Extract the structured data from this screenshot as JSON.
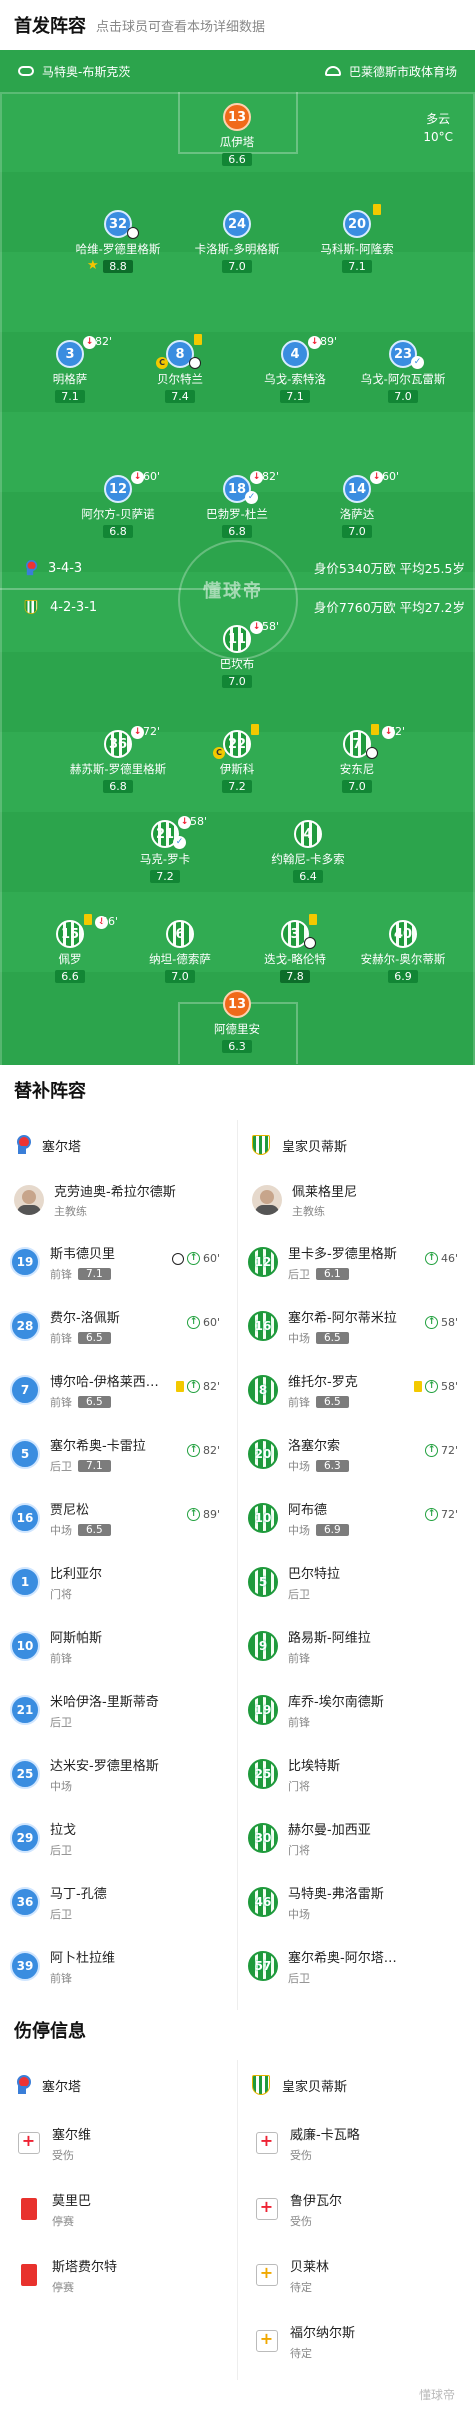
{
  "header": {
    "title": "首发阵容",
    "subtitle": "点击球员可查看本场详细数据"
  },
  "pitch": {
    "coach_home": "马特奥-布斯克茨",
    "venue": "巴莱德斯市政体育场",
    "weather": "多云",
    "temperature": "10°C",
    "watermark": "懂球帝",
    "home": {
      "formation": "3-4-3",
      "value": "身价5340万欧",
      "age": "平均25.5岁"
    },
    "away": {
      "formation": "4-2-3-1",
      "value": "身价7760万欧",
      "age": "平均27.2岁"
    },
    "home_players": [
      {
        "num": "13",
        "name": "瓜伊塔",
        "rating": "6.6"
      },
      {
        "num": "32",
        "name": "哈维-罗德里格斯",
        "rating": "8.8"
      },
      {
        "num": "24",
        "name": "卡洛斯-多明格斯",
        "rating": "7.0"
      },
      {
        "num": "20",
        "name": "马科斯-阿隆索",
        "rating": "7.1"
      },
      {
        "num": "3",
        "name": "明格萨",
        "rating": "7.1",
        "sub": "82'"
      },
      {
        "num": "8",
        "name": "贝尔特兰",
        "rating": "7.4"
      },
      {
        "num": "4",
        "name": "乌戈-索特洛",
        "rating": "7.1",
        "sub": "89'"
      },
      {
        "num": "23",
        "name": "乌戈-阿尔瓦雷斯",
        "rating": "7.0"
      },
      {
        "num": "12",
        "name": "阿尔方-贝萨诺",
        "rating": "6.8",
        "sub": "60'"
      },
      {
        "num": "18",
        "name": "巴勃罗-杜兰",
        "rating": "6.8",
        "sub": "82'"
      },
      {
        "num": "14",
        "name": "洛萨达",
        "rating": "7.0",
        "sub": "60'"
      }
    ],
    "away_players": [
      {
        "num": "11",
        "name": "巴坎布",
        "rating": "7.0",
        "sub": "58'"
      },
      {
        "num": "36",
        "name": "赫苏斯-罗德里格斯",
        "rating": "6.8",
        "sub": "72'"
      },
      {
        "num": "22",
        "name": "伊斯科",
        "rating": "7.2"
      },
      {
        "num": "7",
        "name": "安东尼",
        "rating": "7.0",
        "sub": "72'"
      },
      {
        "num": "21",
        "name": "马克-罗卡",
        "rating": "7.2",
        "sub": "58'"
      },
      {
        "num": "4",
        "name": "约翰尼-卡多索",
        "rating": "6.4"
      },
      {
        "num": "15",
        "name": "佩罗",
        "rating": "6.6",
        "sub": "46'"
      },
      {
        "num": "6",
        "name": "纳坦-德索萨",
        "rating": "7.0"
      },
      {
        "num": "3",
        "name": "迭戈-略伦特",
        "rating": "7.8"
      },
      {
        "num": "40",
        "name": "安赫尔-奥尔蒂斯",
        "rating": "6.9"
      },
      {
        "num": "13",
        "name": "阿德里安",
        "rating": "6.3"
      }
    ]
  },
  "subs": {
    "title": "替补阵容",
    "home_team": "塞尔塔",
    "away_team": "皇家贝蒂斯",
    "home_coach": "克劳迪奥-希拉尔德斯",
    "away_coach": "佩莱格里尼",
    "coach_role": "主教练",
    "home": [
      {
        "num": "19",
        "name": "斯韦德贝里",
        "pos": "前锋",
        "rating": "7.1",
        "time": "60'"
      },
      {
        "num": "28",
        "name": "费尔-洛佩斯",
        "pos": "前锋",
        "rating": "6.5",
        "time": "60'"
      },
      {
        "num": "7",
        "name": "博尔哈-伊格莱西亚斯",
        "pos": "前锋",
        "rating": "6.5",
        "time": "82'"
      },
      {
        "num": "5",
        "name": "塞尔希奥-卡雷拉",
        "pos": "后卫",
        "rating": "7.1",
        "time": "82'"
      },
      {
        "num": "16",
        "name": "贾尼松",
        "pos": "中场",
        "rating": "6.5",
        "time": "89'"
      },
      {
        "num": "1",
        "name": "比利亚尔",
        "pos": "门将"
      },
      {
        "num": "10",
        "name": "阿斯帕斯",
        "pos": "前锋"
      },
      {
        "num": "21",
        "name": "米哈伊洛-里斯蒂奇",
        "pos": "后卫"
      },
      {
        "num": "25",
        "name": "达米安-罗德里格斯",
        "pos": "中场"
      },
      {
        "num": "29",
        "name": "拉戈",
        "pos": "后卫"
      },
      {
        "num": "36",
        "name": "马丁-孔德",
        "pos": "后卫"
      },
      {
        "num": "39",
        "name": "阿卜杜拉维",
        "pos": "前锋"
      }
    ],
    "away": [
      {
        "num": "12",
        "name": "里卡多-罗德里格斯",
        "pos": "后卫",
        "rating": "6.1",
        "time": "46'"
      },
      {
        "num": "16",
        "name": "塞尔希-阿尔蒂米拉",
        "pos": "中场",
        "rating": "6.5",
        "time": "58'"
      },
      {
        "num": "8",
        "name": "维托尔-罗克",
        "pos": "前锋",
        "rating": "6.5",
        "time": "58'"
      },
      {
        "num": "20",
        "name": "洛塞尔索",
        "pos": "中场",
        "rating": "6.3",
        "time": "72'"
      },
      {
        "num": "10",
        "name": "阿布德",
        "pos": "中场",
        "rating": "6.9",
        "time": "72'"
      },
      {
        "num": "5",
        "name": "巴尔特拉",
        "pos": "后卫"
      },
      {
        "num": "9",
        "name": "路易斯-阿维拉",
        "pos": "前锋"
      },
      {
        "num": "19",
        "name": "库乔-埃尔南德斯",
        "pos": "前锋"
      },
      {
        "num": "25",
        "name": "比埃特斯",
        "pos": "门将"
      },
      {
        "num": "30",
        "name": "赫尔曼-加西亚",
        "pos": "门将"
      },
      {
        "num": "46",
        "name": "马特奥-弗洛雷斯",
        "pos": "中场"
      },
      {
        "num": "57",
        "name": "塞尔希奥-阿尔塔米拉",
        "pos": "后卫"
      }
    ]
  },
  "injuries": {
    "title": "伤停信息",
    "home_team": "塞尔塔",
    "away_team": "皇家贝蒂斯",
    "home": [
      {
        "name": "塞尔维",
        "status": "受伤"
      },
      {
        "name": "莫里巴",
        "status": "停赛"
      },
      {
        "name": "斯塔费尔特",
        "status": "停赛"
      }
    ],
    "away": [
      {
        "name": "威廉-卡瓦略",
        "status": "受伤"
      },
      {
        "name": "鲁伊瓦尔",
        "status": "受伤"
      },
      {
        "name": "贝莱林",
        "status": "待定"
      },
      {
        "name": "福尔纳尔斯",
        "status": "待定"
      }
    ]
  },
  "footer_watermark": "懂球帝"
}
